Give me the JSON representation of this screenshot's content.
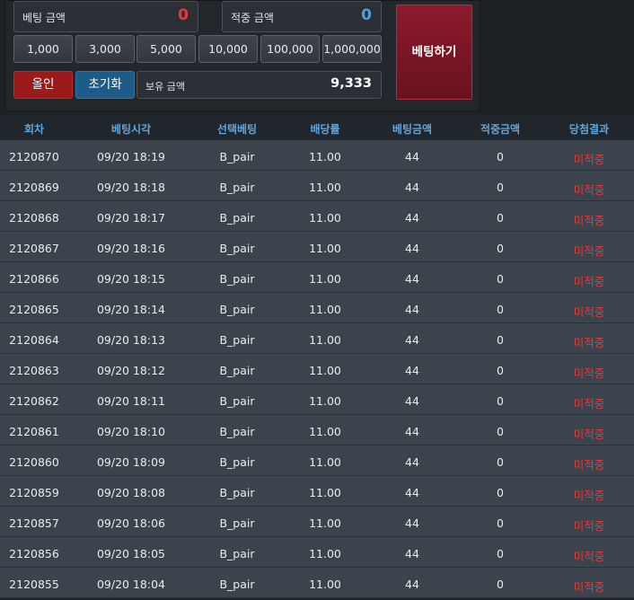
{
  "bet_panel": {
    "bet_amount_label": "베팅 금액",
    "bet_amount_value": "0",
    "win_amount_label": "적중 금액",
    "win_amount_value": "0",
    "chips": [
      "1,000",
      "3,000",
      "5,000",
      "10,000",
      "100,000",
      "1,000,000"
    ],
    "all_in_label": "올인",
    "reset_label": "초기화",
    "balance_label": "보유 금액",
    "balance_value": "9,333",
    "place_bet_label": "베팅하기"
  },
  "history": {
    "columns": [
      "회차",
      "베팅시각",
      "선택베팅",
      "배당률",
      "베팅금액",
      "적중금액",
      "당첨결과"
    ],
    "rows": [
      [
        "2120870",
        "09/20 18:19",
        "B_pair",
        "11.00",
        "44",
        "0",
        "미적중"
      ],
      [
        "2120869",
        "09/20 18:18",
        "B_pair",
        "11.00",
        "44",
        "0",
        "미적중"
      ],
      [
        "2120868",
        "09/20 18:17",
        "B_pair",
        "11.00",
        "44",
        "0",
        "미적중"
      ],
      [
        "2120867",
        "09/20 18:16",
        "B_pair",
        "11.00",
        "44",
        "0",
        "미적중"
      ],
      [
        "2120866",
        "09/20 18:15",
        "B_pair",
        "11.00",
        "44",
        "0",
        "미적중"
      ],
      [
        "2120865",
        "09/20 18:14",
        "B_pair",
        "11.00",
        "44",
        "0",
        "미적중"
      ],
      [
        "2120864",
        "09/20 18:13",
        "B_pair",
        "11.00",
        "44",
        "0",
        "미적중"
      ],
      [
        "2120863",
        "09/20 18:12",
        "B_pair",
        "11.00",
        "44",
        "0",
        "미적중"
      ],
      [
        "2120862",
        "09/20 18:11",
        "B_pair",
        "11.00",
        "44",
        "0",
        "미적중"
      ],
      [
        "2120861",
        "09/20 18:10",
        "B_pair",
        "11.00",
        "44",
        "0",
        "미적중"
      ],
      [
        "2120860",
        "09/20 18:09",
        "B_pair",
        "11.00",
        "44",
        "0",
        "미적중"
      ],
      [
        "2120859",
        "09/20 18:08",
        "B_pair",
        "11.00",
        "44",
        "0",
        "미적중"
      ],
      [
        "2120857",
        "09/20 18:06",
        "B_pair",
        "11.00",
        "44",
        "0",
        "미적중"
      ],
      [
        "2120856",
        "09/20 18:05",
        "B_pair",
        "11.00",
        "44",
        "0",
        "미적중"
      ],
      [
        "2120855",
        "09/20 18:04",
        "B_pair",
        "11.00",
        "44",
        "0",
        "미적중"
      ]
    ]
  }
}
